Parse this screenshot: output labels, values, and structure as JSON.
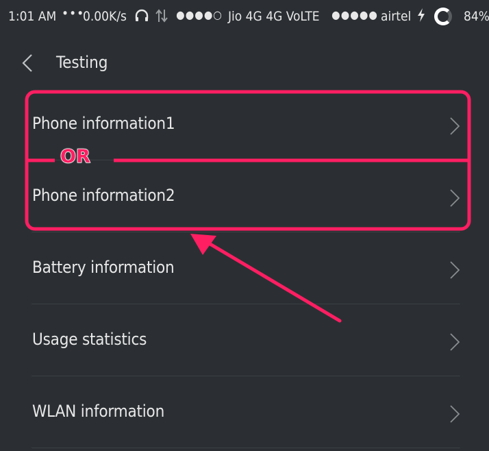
{
  "status_bar": {
    "time": "1:01 AM",
    "dots": "•••",
    "speed": "0.00K/s",
    "headset_icon": "headset-icon",
    "data_icon": "data-transfer-icon",
    "signal1": "●●●●○",
    "carrier1": "Jio 4G 4G VoLTE",
    "signal2": "●●●●●",
    "carrier2": "airtel",
    "charging_icon": "lightning-icon",
    "battery_ring_icon": "battery-ring-icon",
    "battery": "84%"
  },
  "header": {
    "back_icon": "chevron-left-icon",
    "title": "Testing"
  },
  "list": {
    "items": [
      {
        "label": "Phone information1"
      },
      {
        "label": "Phone information2"
      },
      {
        "label": "Battery information"
      },
      {
        "label": "Usage statistics"
      },
      {
        "label": "WLAN information"
      }
    ]
  },
  "annotation": {
    "or_text": "OR",
    "color": "#ff1e62"
  },
  "colors": {
    "background": "#2b2f33",
    "text": "#e8e8e8",
    "chevron": "#8a8d90",
    "divider": "#3b4045"
  }
}
